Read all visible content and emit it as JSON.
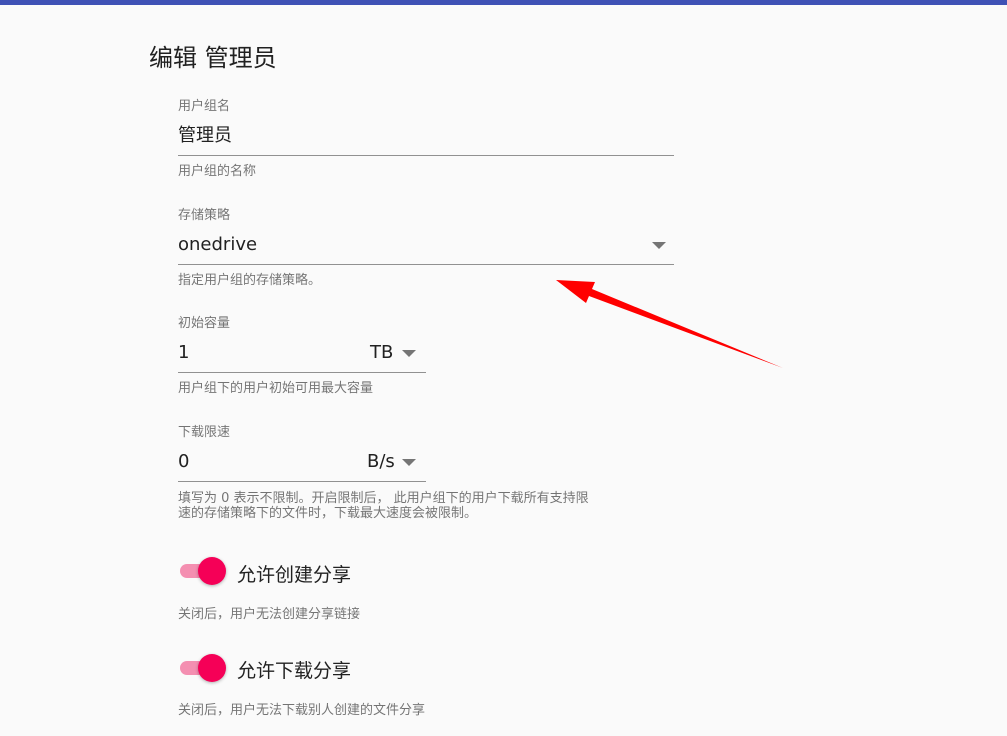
{
  "page_title": "编辑 管理员",
  "group_name": {
    "label": "用户组名",
    "value": "管理员",
    "helper": "用户组的名称"
  },
  "storage_policy": {
    "label": "存储策略",
    "value": "onedrive",
    "helper": "指定用户组的存储策略。"
  },
  "initial_capacity": {
    "label": "初始容量",
    "value": "1",
    "unit": "TB",
    "helper": "用户组下的用户初始可用最大容量"
  },
  "download_speed": {
    "label": "下载限速",
    "value": "0",
    "unit": "B/s",
    "helper_line1": "填写为 0 表示不限制。开启限制后， 此用户组下的用户下载所有支持限",
    "helper_line2": "速的存储策略下的文件时，下载最大速度会被限制。"
  },
  "allow_share": {
    "label": "允许创建分享",
    "enabled": true,
    "helper": "关闭后，用户无法创建分享链接"
  },
  "allow_share_download": {
    "label": "允许下载分享",
    "enabled": true,
    "helper": "关闭后，用户无法下载别人创建的文件分享"
  },
  "colors": {
    "top_bar": "#3f51b5",
    "switch_thumb": "#f50057",
    "switch_track": "#f48fb1",
    "annotation_arrow": "#ff0000"
  }
}
